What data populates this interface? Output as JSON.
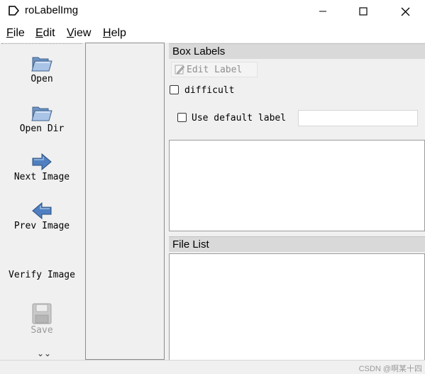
{
  "window": {
    "title": "roLabelImg",
    "icon": "tag-outline-icon",
    "controls": [
      "minimize-icon",
      "maximize-icon",
      "close-icon"
    ]
  },
  "menu": [
    {
      "mnemonic": "F",
      "rest": "ile"
    },
    {
      "mnemonic": "E",
      "rest": "dit"
    },
    {
      "mnemonic": "V",
      "rest": "iew"
    },
    {
      "mnemonic": "H",
      "rest": "elp"
    }
  ],
  "toolbar": {
    "open": "Open",
    "open_dir": "Open Dir",
    "next_image": "Next Image",
    "prev_image": "Prev Image",
    "verify_image": "Verify Image",
    "save": "Save",
    "more_glyph": "⌄⌄"
  },
  "box_labels": {
    "title": "Box Labels",
    "edit_label": "Edit Label",
    "difficult": "difficult",
    "use_default_label": "Use default label",
    "default_label_value": "",
    "difficult_checked": false,
    "use_default_checked": false
  },
  "file_list": {
    "title": "File List"
  },
  "status": {
    "watermark": "CSDN @啊某十四"
  }
}
